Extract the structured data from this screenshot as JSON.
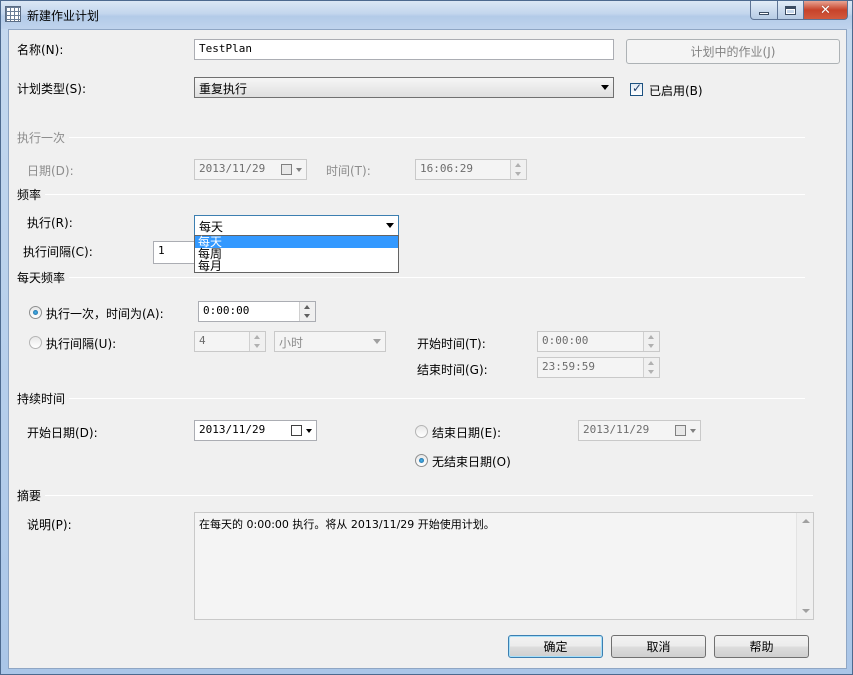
{
  "window": {
    "title": "新建作业计划",
    "min_glyph": "",
    "close_glyph": "✕"
  },
  "name": {
    "label": "名称(N):",
    "value": "TestPlan",
    "jobs_button": "计划中的作业(J)"
  },
  "schedule_type": {
    "label": "计划类型(S):",
    "value": "重复执行",
    "enabled_label": "已启用(B)",
    "enabled_checked": true
  },
  "one_time": {
    "section": "执行一次",
    "date_label": "日期(D):",
    "date_value": "2013/11/29",
    "time_label": "时间(T):",
    "time_value": "16:06:29"
  },
  "frequency": {
    "section": "频率",
    "occurs_label": "执行(R):",
    "occurs_value": "每天",
    "interval_label": "执行间隔(C):",
    "interval_value": "1",
    "options": [
      "每天",
      "每周",
      "每月"
    ],
    "selected_index": 0
  },
  "daily_frequency": {
    "section": "每天频率",
    "once_label": "执行一次，时间为(A):",
    "once_time": "0:00:00",
    "once_selected": true,
    "every_label": "执行间隔(U):",
    "every_value": "4",
    "every_unit": "小时",
    "start_label": "开始时间(T):",
    "start_value": "0:00:00",
    "end_label": "结束时间(G):",
    "end_value": "23:59:59"
  },
  "duration": {
    "section": "持续时间",
    "start_date_label": "开始日期(D):",
    "start_date_value": "2013/11/29",
    "end_date_label": "结束日期(E):",
    "end_date_value": "2013/11/29",
    "no_end_label": "无结束日期(O)",
    "no_end_selected": true
  },
  "summary": {
    "section": "摘要",
    "desc_label": "说明(P):",
    "desc_value": "在每天的 0:00:00 执行。将从 2013/11/29 开始使用计划。"
  },
  "buttons": {
    "ok": "确定",
    "cancel": "取消",
    "help": "帮助"
  }
}
